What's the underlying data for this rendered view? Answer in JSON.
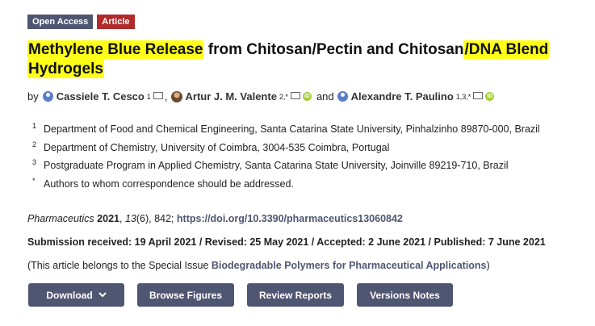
{
  "badges": {
    "open_access": "Open Access",
    "article": "Article"
  },
  "title": {
    "part1": "Methylene Blue Release",
    "part2": " from Chitosan/Pectin and Chitosan",
    "part3": "/DNA Blend",
    "part4": " ",
    "part5": "Hydrogels"
  },
  "authors": {
    "by": "by",
    "a1": {
      "name": "Cassiele T. Cesco",
      "sup": "1"
    },
    "a2": {
      "name": "Artur J. M. Valente",
      "sup": "2,*"
    },
    "and": "and",
    "a3": {
      "name": "Alexandre T. Paulino",
      "sup": "1,3,*"
    },
    "comma": ","
  },
  "affiliations": [
    {
      "num": "1",
      "text": "Department of Food and Chemical Engineering, Santa Catarina State University, Pinhalzinho 89870-000, Brazil"
    },
    {
      "num": "2",
      "text": "Department of Chemistry, University of Coimbra, 3004-535 Coimbra, Portugal"
    },
    {
      "num": "3",
      "text": "Postgraduate Program in Applied Chemistry, Santa Catarina State University, Joinville 89219-710, Brazil"
    },
    {
      "num": "*",
      "text": "Authors to whom correspondence should be addressed."
    }
  ],
  "citation": {
    "journal": "Pharmaceutics",
    "year": "2021",
    "volume": "13",
    "rest": "(6), 842;",
    "doi": "https://doi.org/10.3390/pharmaceutics13060842"
  },
  "dates": "Submission received: 19 April 2021 / Revised: 25 May 2021 / Accepted: 2 June 2021 / Published: 7 June 2021",
  "special_issue": {
    "prefix": "(This article belongs to the Special Issue ",
    "link": "Biodegradable Polymers for Pharmaceutical Applications",
    "suffix": ")"
  },
  "buttons": {
    "download": "Download",
    "browse": "Browse Figures",
    "review": "Review Reports",
    "versions": "Versions Notes"
  },
  "icons": {
    "author": "user-icon",
    "mail": "mail-icon",
    "orcid": "orcid-icon",
    "chevron": "chevron-down-icon"
  },
  "colors": {
    "badge_open_access": "#4f5671",
    "badge_article": "#b12b2b",
    "highlight": "#ffff1a",
    "button": "#4f5671",
    "orcid": "#a6ce39"
  }
}
